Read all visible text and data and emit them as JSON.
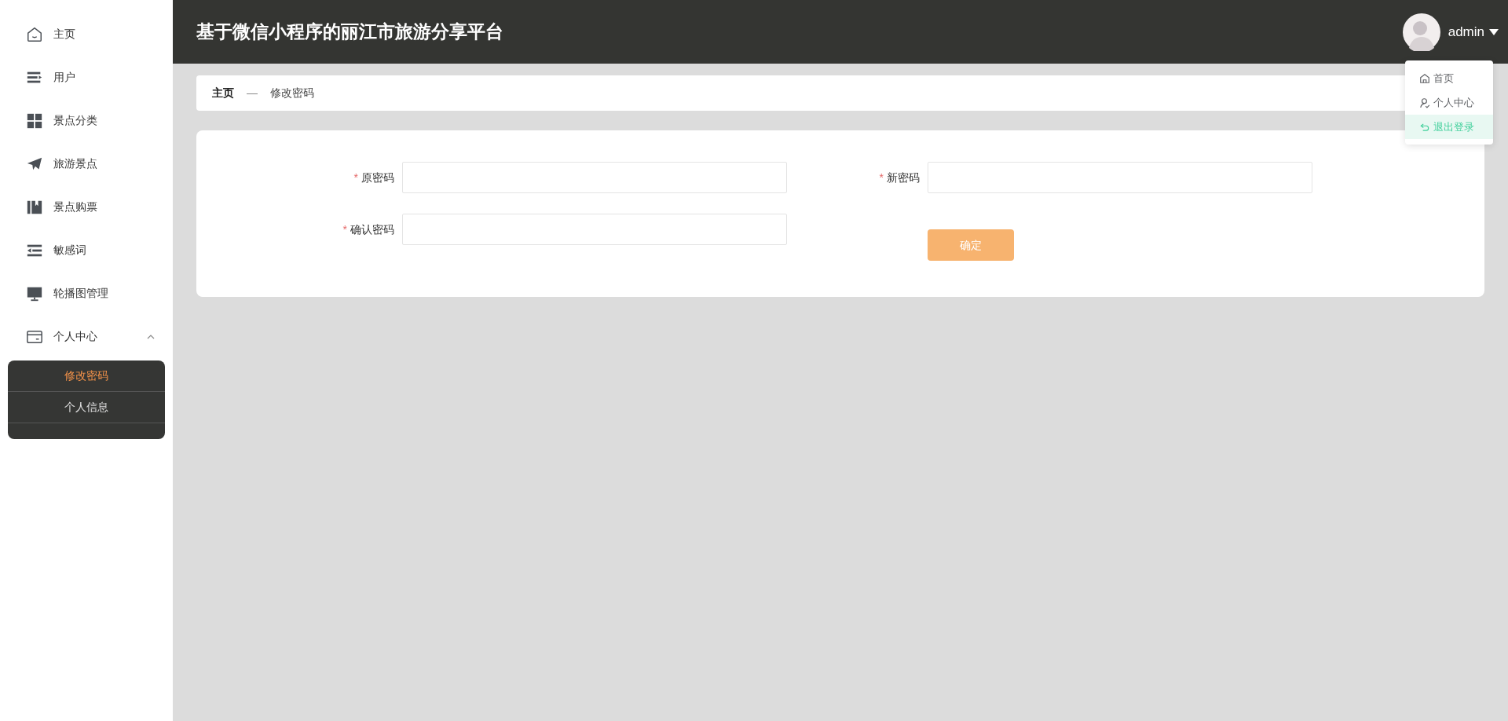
{
  "sidebar": {
    "items": [
      {
        "label": "主页"
      },
      {
        "label": "用户"
      },
      {
        "label": "景点分类"
      },
      {
        "label": "旅游景点"
      },
      {
        "label": "景点购票"
      },
      {
        "label": "敏感词"
      },
      {
        "label": "轮播图管理"
      },
      {
        "label": "个人中心",
        "expanded": true,
        "children": [
          {
            "label": "修改密码",
            "selected": true
          },
          {
            "label": "个人信息",
            "selected": false
          }
        ]
      }
    ]
  },
  "header": {
    "title": "基于微信小程序的丽江市旅游分享平台",
    "user": "admin"
  },
  "user_menu": [
    {
      "label": "首页",
      "selected": false
    },
    {
      "label": "个人中心",
      "selected": false
    },
    {
      "label": "退出登录",
      "selected": true
    }
  ],
  "breadcrumb": {
    "home": "主页",
    "separator": "—",
    "current": "修改密码"
  },
  "form": {
    "fields": [
      {
        "label": "原密码",
        "mark": "*"
      },
      {
        "label": "新密码",
        "mark": "*"
      },
      {
        "label": "确认密码",
        "mark": "*"
      }
    ],
    "submit": "确定"
  }
}
